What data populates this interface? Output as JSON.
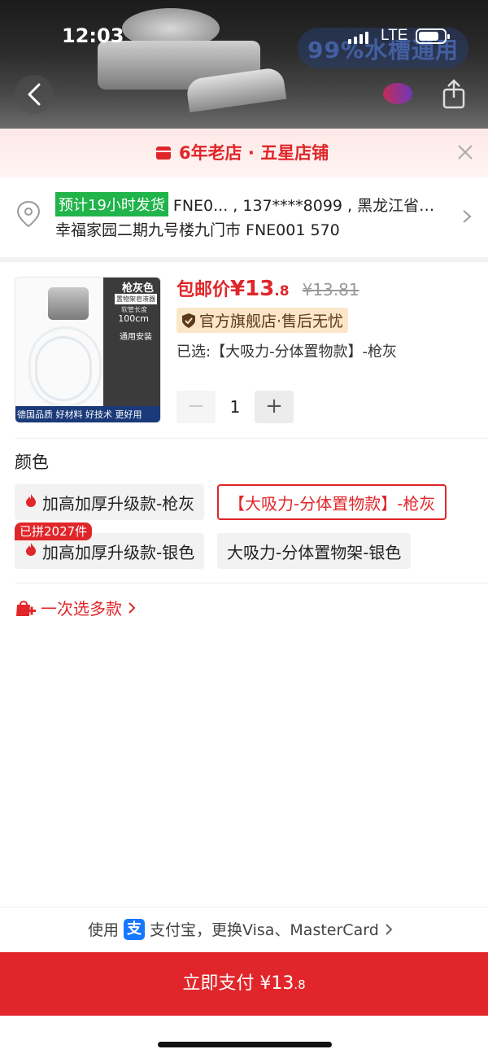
{
  "status_bar": {
    "time": "12:03",
    "network": "LTE"
  },
  "hero": {
    "watermark": "99%水槽通用"
  },
  "store_banner": {
    "text": "6年老店 · 五星店铺"
  },
  "address": {
    "eta": "预计19小时发货",
    "line1": "FNE0... , 137****8099 , 黑龙江省…",
    "line2": "幸福家园二期九号楼九门市 FNE001 570"
  },
  "product": {
    "image": {
      "color_tag": "枪灰色",
      "rack_tag": "置物架皂液器",
      "length_label": "软管长度",
      "length_value": "100cm",
      "install_label": "通用安装",
      "strip_text": "德国品质 好材料 好技术 更好用"
    },
    "price_label": "包邮价",
    "price_main": "¥13",
    "price_decimal": ".8",
    "price_old": "¥13.81",
    "official_badge": "官方旗舰店·售后无忧",
    "selected": "已选:【大吸力-分体置物款】-枪灰",
    "quantity": "1"
  },
  "colors": {
    "title": "颜色",
    "options": [
      {
        "label": "加高加厚升级款-枪灰"
      },
      {
        "label": "【大吸力-分体置物款】-枪灰"
      },
      {
        "label": "加高加厚升级款-银色"
      },
      {
        "label": "大吸力-分体置物架-银色"
      }
    ],
    "group_badge": "已拼2027件"
  },
  "multi_select": {
    "label": "一次选多款 "
  },
  "payment": {
    "method_prefix": "使用",
    "method_suffix": "支付宝，更换Visa、MasterCard",
    "pay_button": "立即支付 ¥13",
    "pay_decimal": ".8"
  },
  "colors_palette": {
    "accent": "#e0262a",
    "eta_green": "#20b44a",
    "alipay_blue": "#1677ff"
  }
}
